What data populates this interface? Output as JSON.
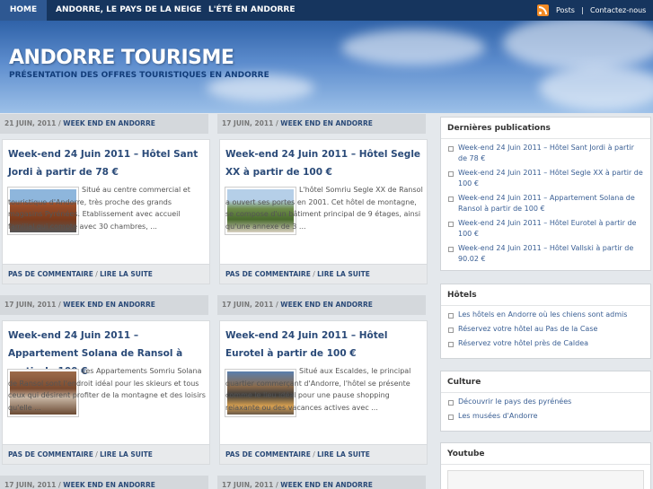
{
  "nav": {
    "items": [
      "HOME",
      "ANDORRE, LE PAYS DE LA NEIGE",
      "L'ÉTÉ EN ANDORRE"
    ],
    "rss_label": "Posts",
    "separator": "|",
    "contact_label": "Contactez-nous"
  },
  "site": {
    "title": "ANDORRE TOURISME",
    "description": "PRÉSENTATION DES OFFRES TOURISTIQUES EN ANDORRE"
  },
  "posts": [
    {
      "date": "21 JUIN, 2011 / ",
      "category": "WEEK END EN ANDORRE",
      "title": "Week-end 24 Juin 2011 – Hôtel Sant Jordi à partir de 78 €",
      "excerpt": "Situé au centre commercial et touristique d'Andorre, très proche des grands magasins Pyrénées. Etablissement avec accueil familial qui compte avec 30 chambres, ...",
      "comments": "PAS DE COMMENTAIRE",
      "sep": " / ",
      "read": "LIRE LA SUITE"
    },
    {
      "date": "17 JUIN, 2011 / ",
      "category": "WEEK END EN ANDORRE",
      "title": "Week-end 24 Juin 2011 – Hôtel Segle XX à partir de 100 €",
      "excerpt": "L'hôtel Somriu Segle XX de Ransol a ouvert ses portes en 2001. Cet hôtel de montagne, se compose d'un bâtiment principal de 9 étages, ainsi qu'une annexe de 3 ...",
      "comments": "PAS DE COMMENTAIRE",
      "sep": " / ",
      "read": "LIRE LA SUITE"
    },
    {
      "date": "17 JUIN, 2011 / ",
      "category": "WEEK END EN ANDORRE",
      "title": "Week-end 24 Juin 2011 – Appartement Solana de Ransol à partir de 100 €",
      "excerpt": "Les Appartements Somriu Solana de Ransol sont l'endroit idéal pour les skieurs et tous ceux qui désirent profiter de la montagne et des loisirs qu'elle ...",
      "comments": "PAS DE COMMENTAIRE",
      "sep": " / ",
      "read": "LIRE LA SUITE"
    },
    {
      "date": "17 JUIN, 2011 / ",
      "category": "WEEK END EN ANDORRE",
      "title": "Week-end 24 Juin 2011 – Hôtel Eurotel à partir de 100 €",
      "excerpt": "Situé aux Escaldes, le principal quartier commerçant d'Andorre, l'hôtel se présente comme le lieu idéal pour une pause shopping relaxante ou des vacances actives avec ...",
      "comments": "PAS DE COMMENTAIRE",
      "sep": " / ",
      "read": "LIRE LA SUITE"
    },
    {
      "date": "17 JUIN, 2011 / ",
      "category": "WEEK END EN ANDORRE"
    },
    {
      "date": "17 JUIN, 2011 / ",
      "category": "WEEK END EN ANDORRE"
    }
  ],
  "sidebar": {
    "recent": {
      "title": "Dernières publications",
      "items": [
        "Week-end 24 Juin 2011 – Hôtel Sant Jordi à partir de 78 €",
        "Week-end 24 Juin 2011 – Hôtel Segle XX à partir de 100 €",
        "Week-end 24 Juin 2011 – Appartement Solana de Ransol à partir de 100 €",
        "Week-end 24 Juin 2011 – Hôtel Eurotel à partir de 100 €",
        "Week-end 24 Juin 2011 – Hôtel Vallski à partir de 90.02 €"
      ]
    },
    "hotels": {
      "title": "Hôtels",
      "items": [
        "Les hôtels en Andorre où les chiens sont admis",
        "Réservez votre hôtel au Pas de la Case",
        "Réservez votre hôtel près de Caldea"
      ]
    },
    "culture": {
      "title": "Culture",
      "items": [
        "Découvrir le pays des pyrénées",
        "Les musées d'Andorre"
      ]
    },
    "youtube": {
      "title": "Youtube"
    }
  }
}
